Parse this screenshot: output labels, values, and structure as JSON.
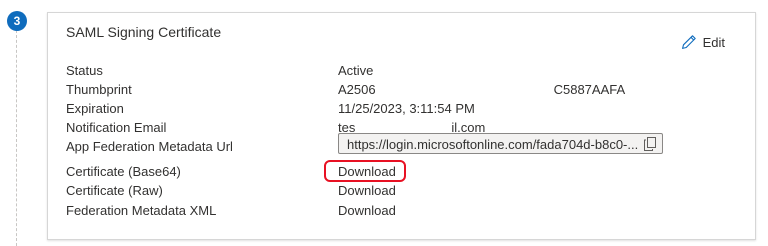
{
  "step": {
    "number": "3"
  },
  "card": {
    "title": "SAML Signing Certificate",
    "edit_label": "Edit"
  },
  "fields": {
    "status": {
      "label": "Status",
      "value": "Active"
    },
    "thumbprint": {
      "label": "Thumbprint",
      "value_start": "A2506",
      "value_end": "C5887AAFA"
    },
    "expiration": {
      "label": "Expiration",
      "value": "11/25/2023, 3:11:54 PM"
    },
    "notification_email": {
      "label": "Notification Email",
      "value_start": "tes",
      "value_end": "il.com"
    },
    "metadata_url": {
      "label": "App Federation Metadata Url",
      "value": "https://login.microsoftonline.com/fada704d-b8c0-..."
    },
    "cert_base64": {
      "label": "Certificate (Base64)",
      "link": "Download"
    },
    "cert_raw": {
      "label": "Certificate (Raw)",
      "link": "Download"
    },
    "federation_xml": {
      "label": "Federation Metadata XML",
      "link": "Download"
    }
  },
  "colors": {
    "accent": "#0f6cbd",
    "highlight": "#e81123"
  }
}
